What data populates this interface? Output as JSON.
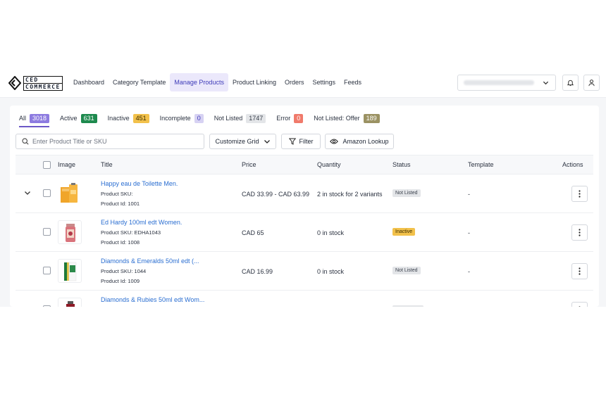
{
  "logo": {
    "line1": "CED",
    "line2": "COMMERCE"
  },
  "nav": {
    "items": [
      {
        "label": "Dashboard"
      },
      {
        "label": "Category Template"
      },
      {
        "label": "Manage Products"
      },
      {
        "label": "Product Linking"
      },
      {
        "label": "Orders"
      },
      {
        "label": "Settings"
      },
      {
        "label": "Feeds"
      }
    ],
    "active_index": 2
  },
  "tabs": [
    {
      "label": "All",
      "count": "3018",
      "color": "#8d7be0",
      "text_color": "#ffffff"
    },
    {
      "label": "Active",
      "count": "631",
      "color": "#1e8a4e",
      "text_color": "#ffffff"
    },
    {
      "label": "Inactive",
      "count": "451",
      "color": "#f2c14b",
      "text_color": "#3a2b00"
    },
    {
      "label": "Incomplete",
      "count": "0",
      "color": "#d7d2f3",
      "text_color": "#3d3ab8"
    },
    {
      "label": "Not Listed",
      "count": "1747",
      "color": "#e3e5e8",
      "text_color": "#3a404c"
    },
    {
      "label": "Error",
      "count": "0",
      "color": "#f07a6b",
      "text_color": "#ffffff"
    },
    {
      "label": "Not Listed: Offer",
      "count": "189",
      "color": "#9b9263",
      "text_color": "#ffffff"
    }
  ],
  "toolbar": {
    "search_placeholder": "Enter Product Title or SKU",
    "customize_label": "Customize Grid",
    "filter_label": "Filter",
    "lookup_label": "Amazon Lookup"
  },
  "table": {
    "headers": {
      "image": "Image",
      "title": "Title",
      "price": "Price",
      "quantity": "Quantity",
      "status": "Status",
      "template": "Template",
      "actions": "Actions"
    },
    "rows": [
      {
        "title": "Happy eau de Toilette Men.",
        "sku": "Product SKU:",
        "id": "Product Id: 1001",
        "price": "CAD 33.99 - CAD 63.99",
        "quantity": "2 in stock for 2 variants",
        "status": "Not Listed",
        "template": "-"
      },
      {
        "title": "Ed Hardy 100ml edt Women.",
        "sku": "Product SKU: EDHA1043",
        "id": "Product Id: 1008",
        "price": "CAD 65",
        "quantity": "0 in stock",
        "status": "Inactive",
        "template": "-"
      },
      {
        "title": "Diamonds & Emeralds 50ml edt (...",
        "sku": "Product SKU: 1044",
        "id": "Product Id: 1009",
        "price": "CAD 16.99",
        "quantity": "0 in stock",
        "status": "Not Listed",
        "template": "-"
      },
      {
        "title": "Diamonds & Rubies 50ml edt Wom..."
      }
    ]
  }
}
